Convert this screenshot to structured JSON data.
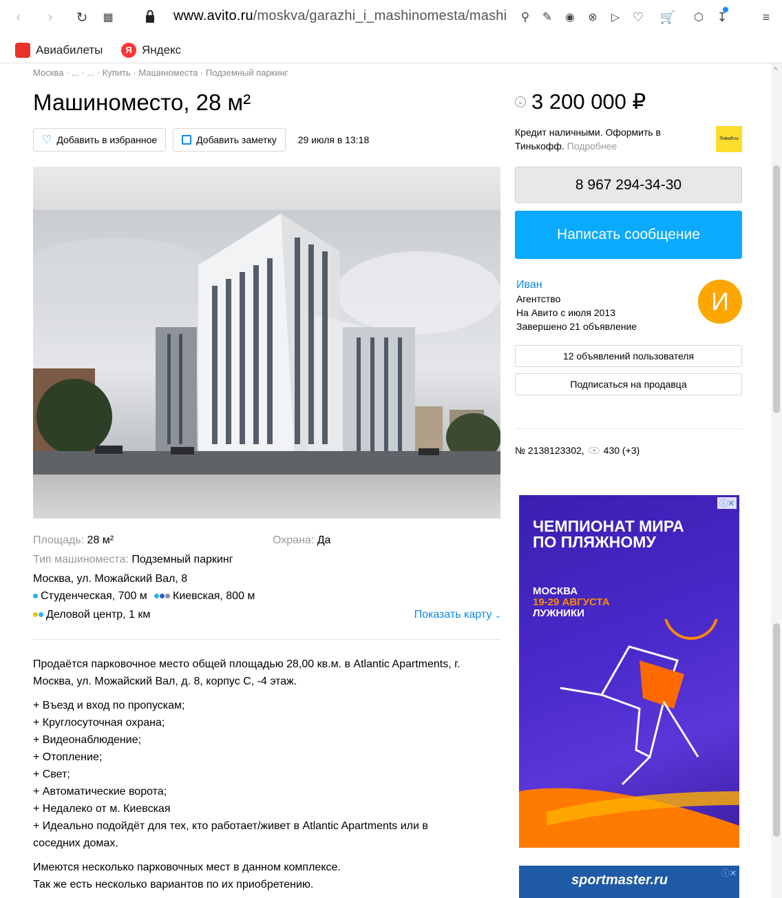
{
  "browser": {
    "url_domain": "www.avito.ru",
    "url_path": "/moskva/garazhi_i_mashinomesta/mashinome",
    "bookmarks": [
      {
        "label": "Авиабилеты",
        "icon": "aviabilety-icon",
        "color": "#e8322a"
      },
      {
        "label": "Яндекс",
        "icon": "yandex-icon",
        "color": "#ff3333"
      }
    ]
  },
  "breadcrumbs": "Москва · ... · ... · Купить · Машиноместа · Подземный паркинг",
  "listing": {
    "title": "Машиноместо, 28 м²",
    "favorite_label": "Добавить в избранное",
    "note_label": "Добавить заметку",
    "date": "29 июля в 13:18"
  },
  "params": {
    "area_label": "Площадь:",
    "area_value": "28 м²",
    "security_label": "Охрана:",
    "security_value": "Да",
    "type_label": "Тип машиноместа:",
    "type_value": "Подземный паркинг",
    "address": "Москва, ул. Можайский Вал, 8",
    "metro": [
      {
        "name": "Студенческая, 700 м",
        "color": "#2db3f0"
      },
      {
        "name": "Киевская, 800 м",
        "color": "#2a60c8"
      },
      {
        "name": "Деловой центр, 1 км",
        "color": "#f5c000"
      }
    ],
    "show_map": "Показать карту"
  },
  "description": {
    "intro": "Продаётся парковочное место общей площадью 28,00 кв.м. в Atlantic Apartments, г. Москва, ул. Можайский Вал, д. 8, корпус С, -4 этаж.",
    "features": [
      "+ Въезд и вход по пропускам;",
      "+ Круглосуточная охрана;",
      "+ Видеонаблюдение;",
      "+ Отопление;",
      "+ Свет;",
      "+ Автоматические ворота;",
      "+ Недалеко от м. Киевская",
      "+ Идеально подойдёт для тех, кто работает/живет в Atlantic Apartments или в соседних домах."
    ],
    "outro_1": "Имеются несколько парковочных мест в данном комплексе.",
    "outro_2": "Так же есть несколько вариантов по их приобретению."
  },
  "sidebar": {
    "price": "3 200 000 ₽",
    "credit_text": "Кредит наличными. Оформить в Тинькофф.",
    "credit_more": "Подробнее",
    "tinkoff_logo": "Tinkoff.ru",
    "phone": "8 967 294-34-30",
    "message_label": "Написать сообщение",
    "seller_name": "Иван",
    "seller_type": "Агентство",
    "seller_since": "На Авито с июля 2013",
    "seller_done": "Завершено 21 объявление",
    "avatar_letter": "И",
    "user_ads": "12 объявлений пользователя",
    "subscribe": "Подписаться на продавца",
    "ad_number": "№ 2138123302,",
    "views": "430 (+3)"
  },
  "ads": {
    "banner1_title": "ЧЕМПИОНАТ МИРА ПО ПЛЯЖНОМУ",
    "banner1_city": "МОСКВА",
    "banner1_dates": "19-29 АВГУСТА",
    "banner1_venue": "ЛУЖНИКИ",
    "banner2_text": "sportmaster.ru"
  },
  "colors": {
    "link": "#0a88f0",
    "primary_button": "#0aaaff",
    "avatar": "#ffa600"
  }
}
